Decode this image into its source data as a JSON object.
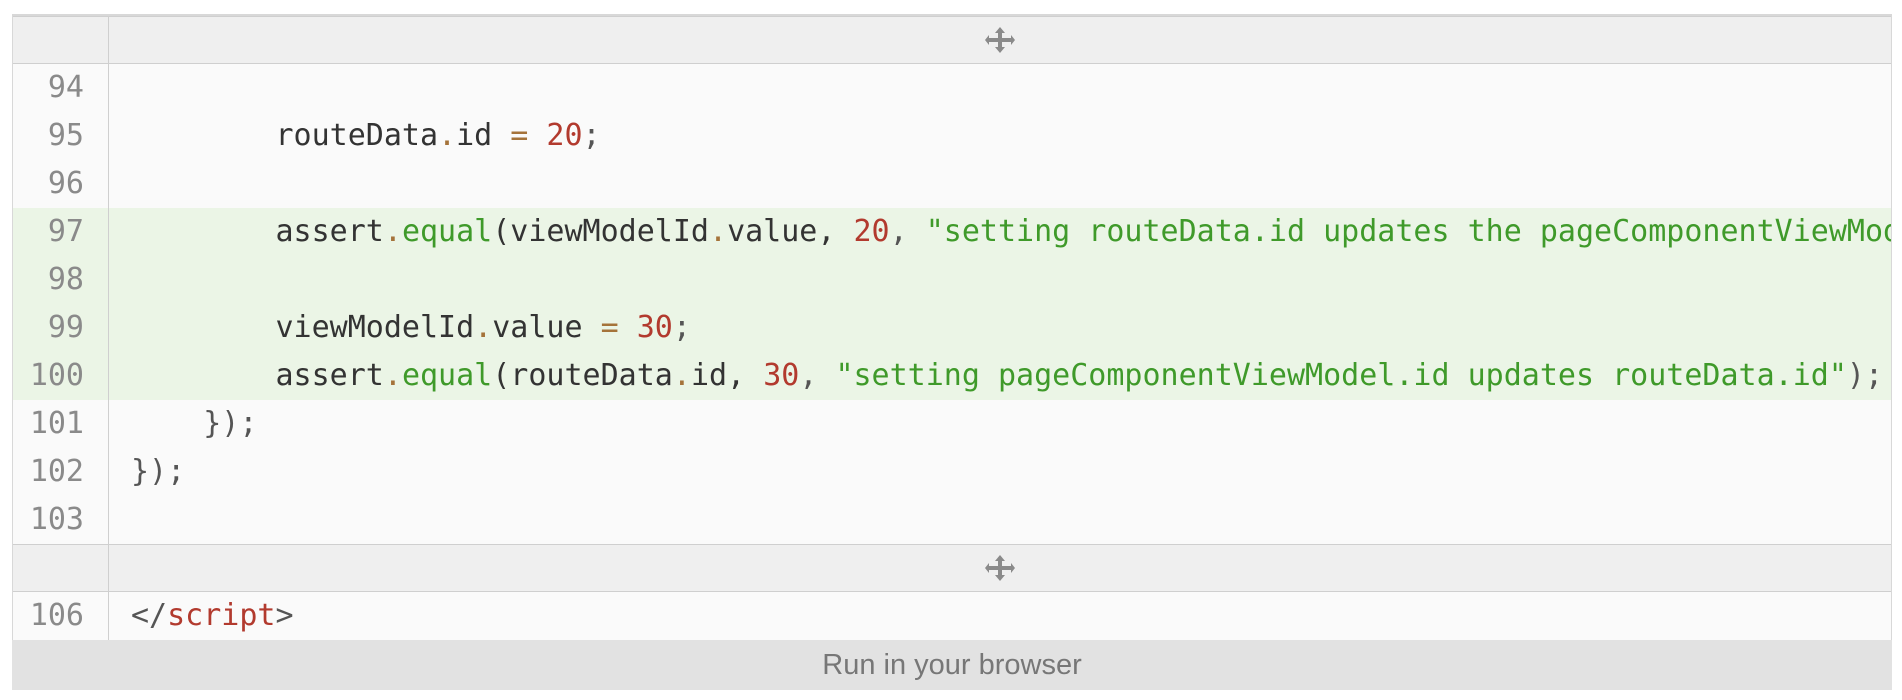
{
  "expand_icon": "expand-vertical-icon",
  "colors": {
    "highlight": "#ebf5e6",
    "number": "#b23a2e",
    "string": "#3f9a2a",
    "keyword_fn": "#3f9a2a",
    "operator": "#a5733a",
    "run_bar": "#e2e2e2"
  },
  "lines": {
    "l94": {
      "num": "94"
    },
    "l95": {
      "num": "95",
      "t": [
        "        routeData",
        ".",
        "id",
        " = ",
        "20",
        ";"
      ]
    },
    "l96": {
      "num": "96"
    },
    "l97": {
      "num": "97",
      "t": [
        "        assert",
        ".",
        "equal",
        "(viewModelId",
        ".",
        "value, ",
        "20",
        ", ",
        "\"setting routeData.id updates the pageComponentViewModel.id\"",
        ");"
      ]
    },
    "l98": {
      "num": "98"
    },
    "l99": {
      "num": "99",
      "t": [
        "        viewModelId",
        ".",
        "value ",
        "=",
        " ",
        "30",
        ";"
      ]
    },
    "l100": {
      "num": "100",
      "t": [
        "        assert",
        ".",
        "equal",
        "(routeData",
        ".",
        "id, ",
        "30",
        ", ",
        "\"setting pageComponentViewModel.id updates routeData.id\"",
        ");"
      ]
    },
    "l101": {
      "num": "101",
      "t": [
        "    });"
      ]
    },
    "l102": {
      "num": "102",
      "t": [
        "});"
      ]
    },
    "l103": {
      "num": "103"
    },
    "l106": {
      "num": "106",
      "t": [
        "</",
        "script",
        ">"
      ]
    }
  },
  "run_button": "Run in your browser"
}
